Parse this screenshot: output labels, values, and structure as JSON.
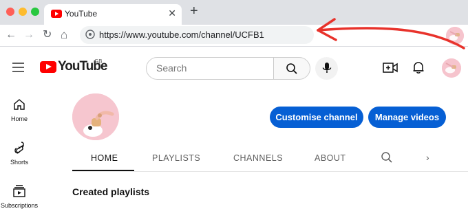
{
  "browser": {
    "tab_title": "YouTube",
    "tab_close": "✕",
    "new_tab": "+",
    "url": "https://www.youtube.com/channel/UCFB1",
    "back": "←",
    "forward": "→",
    "reload": "↻",
    "home": "⌂"
  },
  "header": {
    "logo_text": "YouTube",
    "country_code": "GB",
    "search_placeholder": "Search"
  },
  "sidebar": {
    "items": [
      {
        "label": "Home",
        "icon": "home-icon"
      },
      {
        "label": "Shorts",
        "icon": "shorts-icon"
      },
      {
        "label": "Subscriptions",
        "icon": "subscriptions-icon"
      }
    ]
  },
  "channel": {
    "customise_label": "Customise channel",
    "manage_label": "Manage videos",
    "tabs": [
      "HOME",
      "PLAYLISTS",
      "CHANNELS",
      "ABOUT"
    ],
    "active_tab": "HOME",
    "tab_next": "›",
    "section_title": "Created playlists"
  },
  "colors": {
    "accent_blue": "#065fd4",
    "youtube_red": "#ff0000",
    "annotation_red": "#e8322b"
  }
}
